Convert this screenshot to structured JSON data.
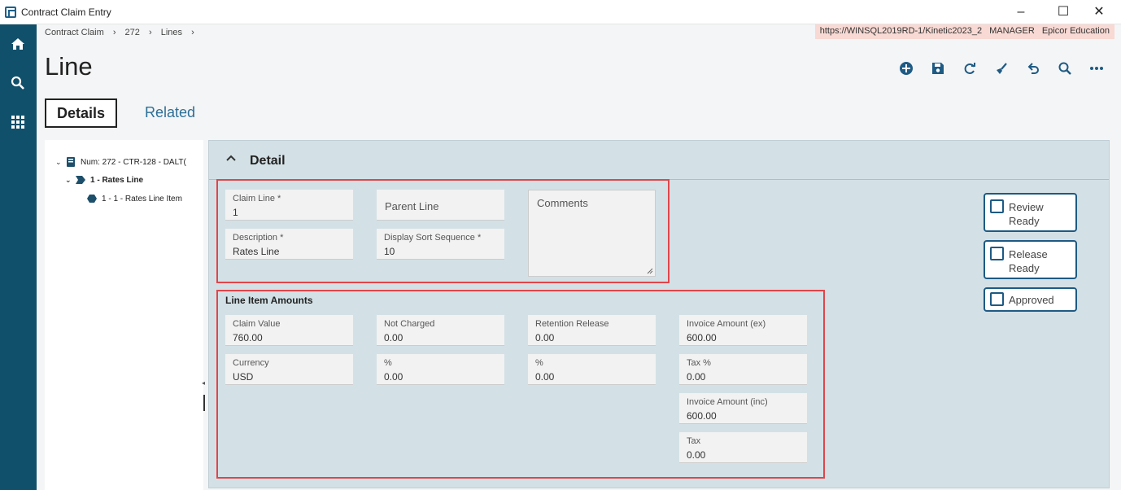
{
  "window": {
    "title": "Contract Claim Entry",
    "minimize": "–",
    "maximize": "☐",
    "close": "✕"
  },
  "breadcrumb": [
    "Contract Claim",
    "›",
    "272",
    "›",
    "Lines",
    "›"
  ],
  "env": {
    "server": "https://WINSQL2019RD-1/Kinetic2023_2",
    "user": "MANAGER",
    "company": "Epicor Education"
  },
  "page": {
    "title": "Line"
  },
  "tabs": {
    "details": "Details",
    "related": "Related"
  },
  "tree": {
    "root": "Num: 272 - CTR-128 - DALT(",
    "child": "1 - Rates Line",
    "grandchild": "1 - 1 - Rates Line Item"
  },
  "panel": {
    "title": "Detail"
  },
  "fields": {
    "claim_line": {
      "label": "Claim Line *",
      "value": "1"
    },
    "parent_line": {
      "placeholder": "Parent Line"
    },
    "comments": {
      "placeholder": "Comments"
    },
    "description": {
      "label": "Description *",
      "value": "Rates Line"
    },
    "display_sort": {
      "label": "Display Sort Sequence *",
      "value": "10"
    }
  },
  "amounts": {
    "title": "Line Item Amounts",
    "claim_value": {
      "label": "Claim Value",
      "value": "760.00"
    },
    "not_charged": {
      "label": "Not Charged",
      "value": "0.00"
    },
    "retention_release": {
      "label": "Retention Release",
      "value": "0.00"
    },
    "invoice_amount_ex": {
      "label": "Invoice Amount (ex)",
      "value": "600.00"
    },
    "currency": {
      "label": "Currency",
      "value": "USD"
    },
    "not_charged_pct": {
      "label": "%",
      "value": "0.00"
    },
    "retention_pct": {
      "label": "%",
      "value": "0.00"
    },
    "tax_pct": {
      "label": "Tax %",
      "value": "0.00"
    },
    "invoice_amount_inc": {
      "label": "Invoice Amount (inc)",
      "value": "600.00"
    },
    "tax": {
      "label": "Tax",
      "value": "0.00"
    }
  },
  "checks": {
    "review_ready": {
      "line1": "Review",
      "line2": "Ready",
      "checked": false
    },
    "release_ready": {
      "line1": "Release",
      "line2": "Ready",
      "checked": false
    },
    "approved": {
      "line1": "Approved",
      "checked": false
    }
  },
  "colors": {
    "rail": "#10506b",
    "accent": "#1d5a84",
    "panel": "#d3e1e6",
    "highlight": "#e0454a"
  }
}
